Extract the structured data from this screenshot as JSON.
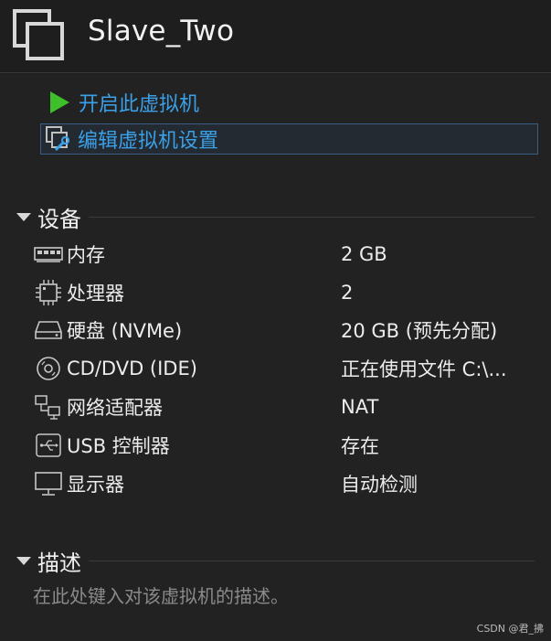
{
  "header": {
    "title": "Slave_Two"
  },
  "actions": {
    "start_label": "开启此虚拟机",
    "edit_label": "编辑虚拟机设置"
  },
  "devices": {
    "heading": "设备",
    "items": [
      {
        "name": "内存",
        "value": "2 GB",
        "icon": "memory-icon"
      },
      {
        "name": "处理器",
        "value": "2",
        "icon": "cpu-icon"
      },
      {
        "name": "硬盘 (NVMe)",
        "value": "20 GB (预先分配)",
        "icon": "hard-disk-icon"
      },
      {
        "name": "CD/DVD (IDE)",
        "value": "正在使用文件 C:\\...",
        "icon": "cd-dvd-icon"
      },
      {
        "name": "网络适配器",
        "value": "NAT",
        "icon": "network-adapter-icon"
      },
      {
        "name": "USB 控制器",
        "value": "存在",
        "icon": "usb-icon"
      },
      {
        "name": "显示器",
        "value": "自动检测",
        "icon": "display-icon"
      }
    ]
  },
  "description": {
    "heading": "描述",
    "placeholder": "在此处键入对该虚拟机的描述。"
  },
  "watermark": "CSDN @君_拂",
  "colors": {
    "accent_blue": "#3aa0e8",
    "play_green": "#3fbf2a",
    "background": "#222222"
  }
}
